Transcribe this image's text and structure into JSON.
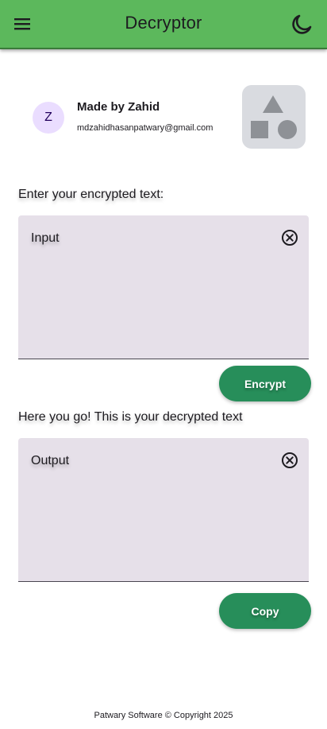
{
  "appbar": {
    "title": "Decryptor",
    "menu_icon": "menu-icon",
    "theme_icon": "dark-mode-moon-icon"
  },
  "profile": {
    "avatar_letter": "Z",
    "name": "Made by Zahid",
    "email": "mdzahidhasanpatwary@gmail.com",
    "image_icon": "shapes-placeholder-icon"
  },
  "input_section": {
    "label": "Enter your encrypted text:",
    "placeholder": "Input",
    "button": "Encrypt"
  },
  "output_section": {
    "label": "Here you go! This is your decrypted text",
    "placeholder": "Output",
    "button": "Copy"
  },
  "footer": {
    "text": "Patwary Software © Copyright 2025"
  },
  "colors": {
    "appbar": "#5cb85c",
    "button": "#278e5a",
    "field": "#e6e0e9",
    "avatar": "#eaddff"
  }
}
